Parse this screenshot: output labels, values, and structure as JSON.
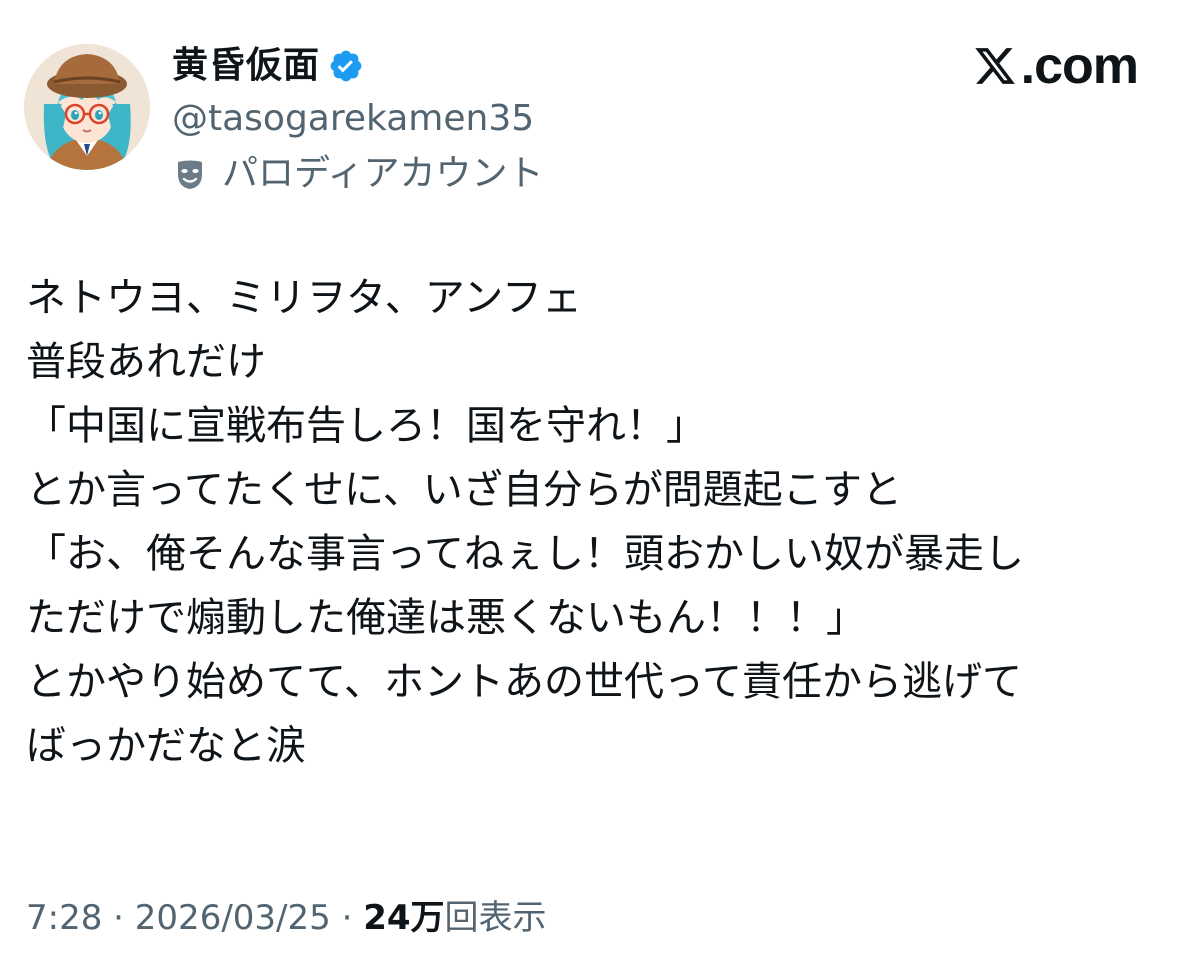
{
  "brand": {
    "logo_text": ".com",
    "icon": "x-logo-icon"
  },
  "author": {
    "display_name": "黄昏仮面",
    "handle": "@tasogarekamen35",
    "account_label": "パロディアカウント",
    "verified_icon": "verified-badge-icon",
    "label_icon": "theater-mask-icon",
    "verified_color": "#1d9bf0"
  },
  "tweet": {
    "lines": [
      "ネトウヨ、ミリヲタ、アンフェ",
      "普段あれだけ",
      "「中国に宣戦布告しろ！国を守れ！」",
      "とか言ってたくせに、いざ自分らが問題起こすと",
      "「お、俺そんな事言ってねぇし！頭おかしい奴が暴走し",
      "ただけで煽動した俺達は悪くないもん！！！」",
      "とかやり始めてて、ホントあの世代って責任から逃げて",
      "ばっかだなと涙"
    ]
  },
  "meta": {
    "time": "7:28",
    "separator": " · ",
    "date": "2026/03/25",
    "views_count": "24万",
    "views_label": "回表示"
  },
  "colors": {
    "text_primary": "#0f1419",
    "text_secondary": "#536471",
    "accent": "#1d9bf0"
  }
}
